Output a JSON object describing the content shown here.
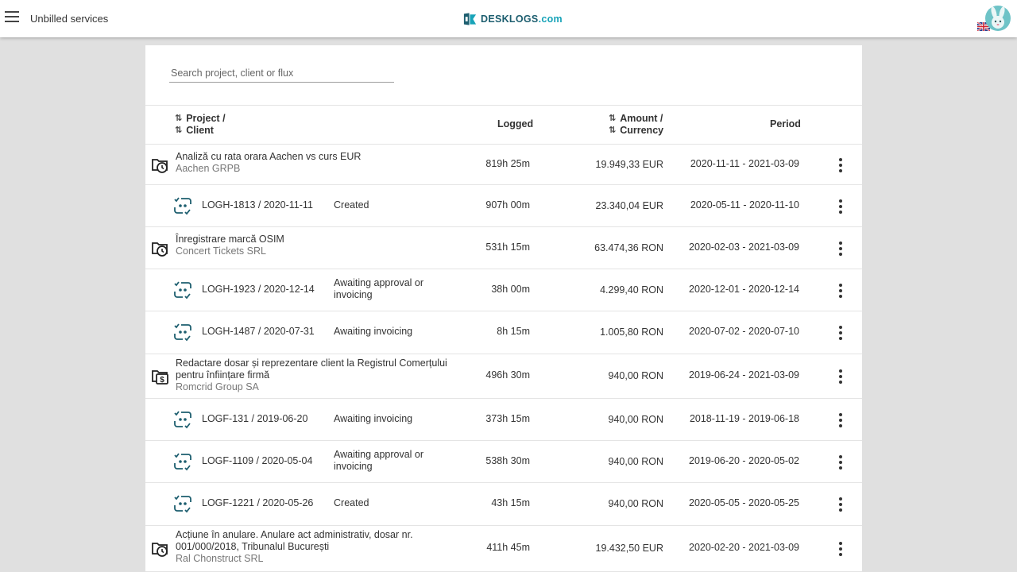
{
  "header": {
    "title": "Unbilled services",
    "logo_main": "DESKLOGS",
    "logo_suffix": ".com",
    "accent": "#1d5e6f"
  },
  "search": {
    "placeholder": "Search project, client or flux"
  },
  "columns": {
    "project": "Project /",
    "client": "Client",
    "logged": "Logged",
    "amount": "Amount /",
    "currency": "Currency",
    "period": "Period"
  },
  "rows": [
    {
      "kind": "project",
      "icon": "folder-clock-icon",
      "title": "Analiză cu rata orara Aachen vs curs EUR",
      "client": "Aachen GRPB",
      "logged": "819h 25m",
      "amount": "19.949,33 EUR",
      "period": "2020-11-11 - 2021-03-09"
    },
    {
      "kind": "flux",
      "icon": "log-flux-icon",
      "code": "LOGH-1813 / 2020-11-11",
      "status": "Created",
      "logged": "907h 00m",
      "amount": "23.340,04 EUR",
      "period": "2020-05-11 - 2020-11-10"
    },
    {
      "kind": "project",
      "icon": "folder-clock-icon",
      "title": "Înregistrare marcă OSIM",
      "client": "Concert Tickets SRL",
      "logged": "531h 15m",
      "amount": "63.474,36 RON",
      "period": "2020-02-03 - 2021-03-09"
    },
    {
      "kind": "flux",
      "icon": "log-flux-icon",
      "code": "LOGH-1923 / 2020-12-14",
      "status": "Awaiting approval or invoicing",
      "logged": "38h 00m",
      "amount": "4.299,40 RON",
      "period": "2020-12-01 - 2020-12-14"
    },
    {
      "kind": "flux",
      "icon": "log-flux-icon",
      "code": "LOGH-1487 / 2020-07-31",
      "status": "Awaiting invoicing",
      "logged": "8h 15m",
      "amount": "1.005,80 RON",
      "period": "2020-07-02 - 2020-07-10"
    },
    {
      "kind": "project",
      "icon": "folder-dollar-icon",
      "title": "Redactare dosar și reprezentare client la Registrul Comerțului pentru înființare firmă",
      "client": "Romcrid Group SA",
      "logged": "496h 30m",
      "amount": "940,00 RON",
      "period": "2019-06-24 - 2021-03-09"
    },
    {
      "kind": "flux",
      "icon": "log-flux-icon",
      "code": "LOGF-131 / 2019-06-20",
      "status": "Awaiting invoicing",
      "logged": "373h 15m",
      "amount": "940,00 RON",
      "period": "2018-11-19 - 2019-06-18"
    },
    {
      "kind": "flux",
      "icon": "log-flux-icon",
      "code": "LOGF-1109 / 2020-05-04",
      "status": "Awaiting approval or invoicing",
      "logged": "538h 30m",
      "amount": "940,00 RON",
      "period": "2019-06-20 - 2020-05-02"
    },
    {
      "kind": "flux",
      "icon": "log-flux-icon",
      "code": "LOGF-1221 / 2020-05-26",
      "status": "Created",
      "logged": "43h 15m",
      "amount": "940,00 RON",
      "period": "2020-05-05 - 2020-05-25"
    },
    {
      "kind": "project",
      "icon": "folder-clock-icon",
      "title": "Acțiune în anulare. Anulare act administrativ, dosar nr. 001/000/2018, Tribunalul București",
      "client": "Ral Chonstruct SRL",
      "logged": "411h 45m",
      "amount": "19.432,50 EUR",
      "period": "2020-02-20 - 2021-03-09"
    }
  ]
}
